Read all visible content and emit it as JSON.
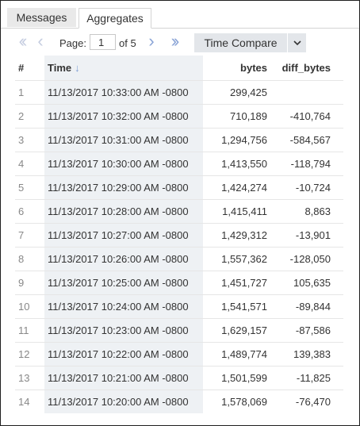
{
  "tabs": [
    {
      "label": "Messages",
      "active": false
    },
    {
      "label": "Aggregates",
      "active": true
    }
  ],
  "pager": {
    "label": "Page:",
    "current_page": "1",
    "of_text": "of 5",
    "icons": [
      "first-page-icon",
      "prev-page-icon",
      "next-page-icon",
      "last-page-icon"
    ]
  },
  "compare": {
    "label": "Time Compare",
    "dropdown_icon": "chevron-down-icon"
  },
  "table": {
    "columns": {
      "num": "#",
      "time": "Time",
      "bytes": "bytes",
      "diff": "diff_bytes"
    },
    "sort_icon": "sort-descending-arrow-icon",
    "rows": [
      {
        "num": "1",
        "time": "11/13/2017 10:33:00 AM -0800",
        "bytes": "299,425",
        "diff": ""
      },
      {
        "num": "2",
        "time": "11/13/2017 10:32:00 AM -0800",
        "bytes": "710,189",
        "diff": "-410,764"
      },
      {
        "num": "3",
        "time": "11/13/2017 10:31:00 AM -0800",
        "bytes": "1,294,756",
        "diff": "-584,567"
      },
      {
        "num": "4",
        "time": "11/13/2017 10:30:00 AM -0800",
        "bytes": "1,413,550",
        "diff": "-118,794"
      },
      {
        "num": "5",
        "time": "11/13/2017 10:29:00 AM -0800",
        "bytes": "1,424,274",
        "diff": "-10,724"
      },
      {
        "num": "6",
        "time": "11/13/2017 10:28:00 AM -0800",
        "bytes": "1,415,411",
        "diff": "8,863"
      },
      {
        "num": "7",
        "time": "11/13/2017 10:27:00 AM -0800",
        "bytes": "1,429,312",
        "diff": "-13,901"
      },
      {
        "num": "8",
        "time": "11/13/2017 10:26:00 AM -0800",
        "bytes": "1,557,362",
        "diff": "-128,050"
      },
      {
        "num": "9",
        "time": "11/13/2017 10:25:00 AM -0800",
        "bytes": "1,451,727",
        "diff": "105,635"
      },
      {
        "num": "10",
        "time": "11/13/2017 10:24:00 AM -0800",
        "bytes": "1,541,571",
        "diff": "-89,844"
      },
      {
        "num": "11",
        "time": "11/13/2017 10:23:00 AM -0800",
        "bytes": "1,629,157",
        "diff": "-87,586"
      },
      {
        "num": "12",
        "time": "11/13/2017 10:22:00 AM -0800",
        "bytes": "1,489,774",
        "diff": "139,383"
      },
      {
        "num": "13",
        "time": "11/13/2017 10:21:00 AM -0800",
        "bytes": "1,501,599",
        "diff": "-11,825"
      },
      {
        "num": "14",
        "time": "11/13/2017 10:20:00 AM -0800",
        "bytes": "1,578,069",
        "diff": "-76,470"
      }
    ]
  }
}
